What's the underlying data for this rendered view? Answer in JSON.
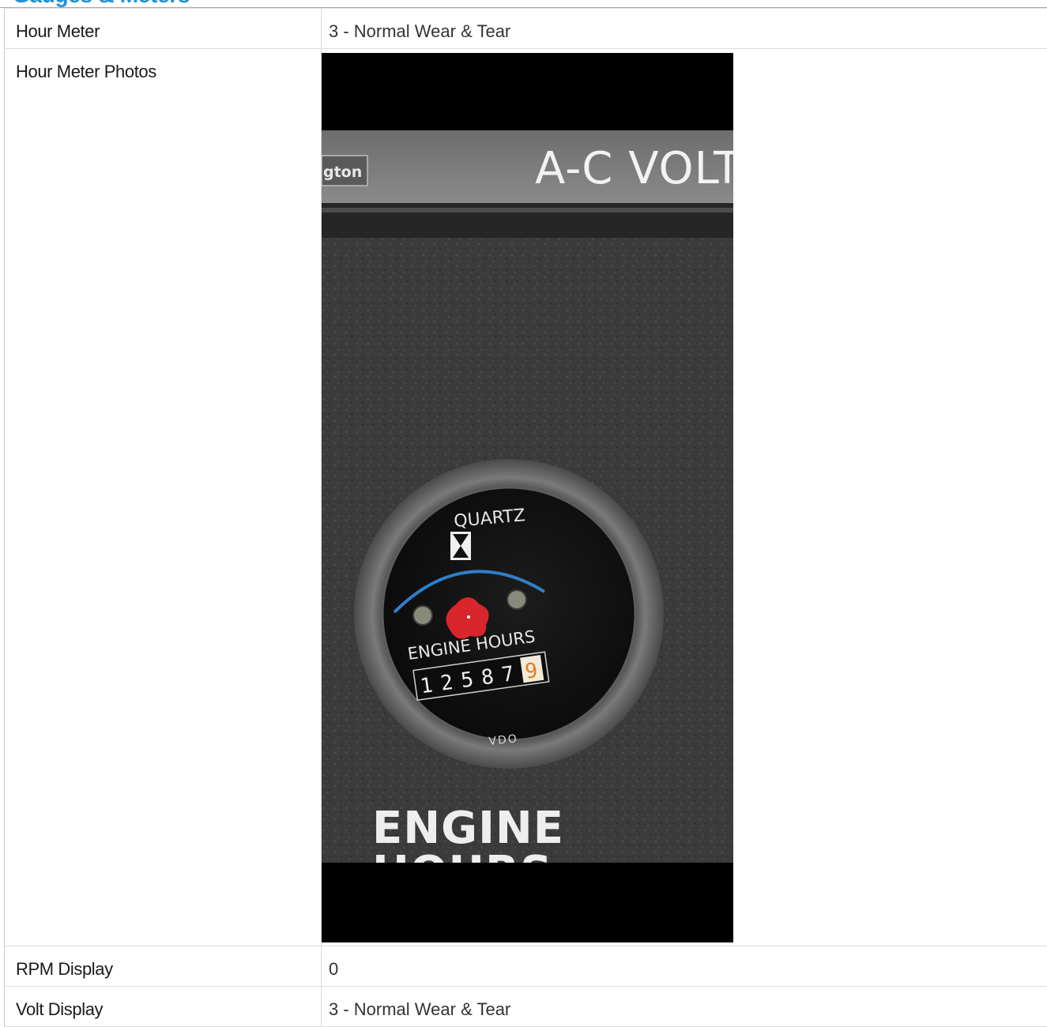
{
  "section": {
    "title": "Gauges & Meters"
  },
  "rows": [
    {
      "label": "Hour Meter",
      "value": "3 - Normal Wear & Tear"
    },
    {
      "label": "Hour Meter Photos",
      "photo": "engine-hour-meter-photo"
    },
    {
      "label": "RPM Display",
      "value": "0"
    },
    {
      "label": "Volt Display",
      "value": "3 - Normal Wear & Tear"
    }
  ],
  "photo_text": {
    "nameplate_left": "gton",
    "nameplate_right": "A-C VOLT",
    "gauge_brand_top": "QUARTZ",
    "gauge_caption": "ENGINE HOURS",
    "gauge_brand_bottom": "VDO",
    "panel_label": "ENGINE",
    "panel_label_2": "HOURS",
    "counter_digits": [
      "1",
      "2",
      "5",
      "8",
      "7",
      "9"
    ]
  },
  "colors": {
    "section_title": "#1e90d6",
    "panel": "#3a3a3a",
    "gauge_arc": "#2f7fc9",
    "reset_knob": "#d8262c",
    "last_digit_bg": "#e07a2a"
  }
}
